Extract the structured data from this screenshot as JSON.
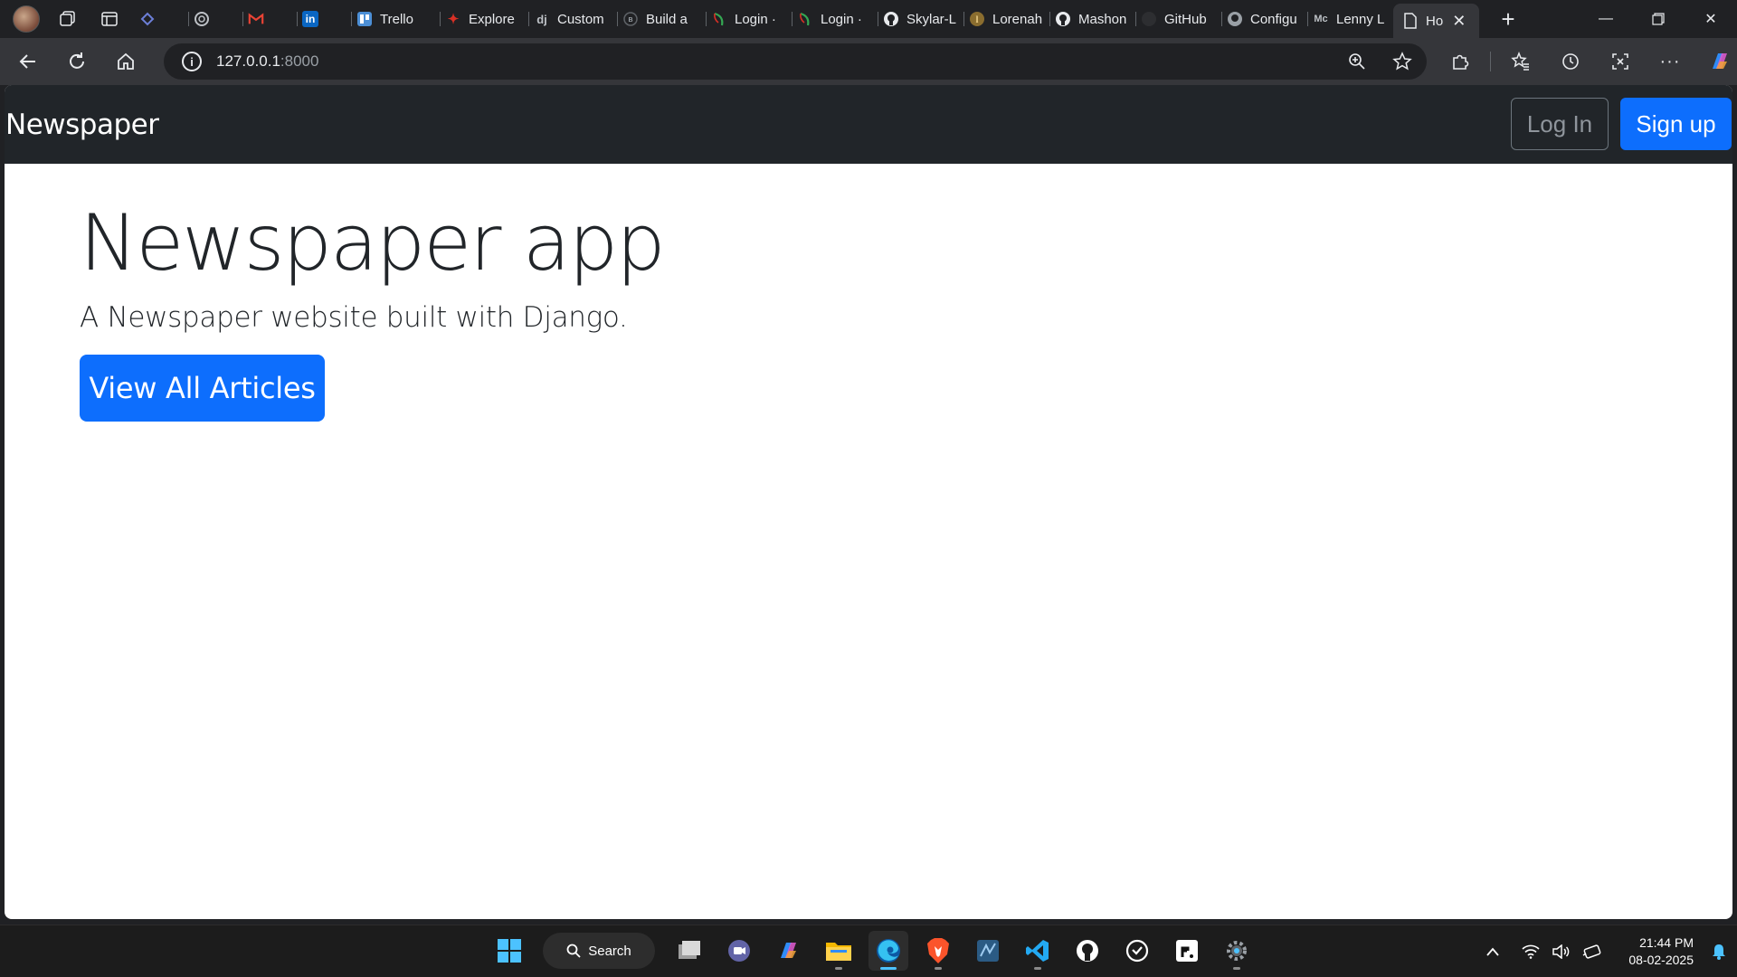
{
  "browser": {
    "tabs": [
      {
        "label": "",
        "icon": "perplexity-icon"
      },
      {
        "label": "",
        "icon": "chatgpt-icon"
      },
      {
        "label": "",
        "icon": "gmail-icon"
      },
      {
        "label": "",
        "icon": "linkedin-icon"
      },
      {
        "label": "Trello",
        "icon": "trello-icon"
      },
      {
        "label": "Explore",
        "icon": "maple-leaf-icon"
      },
      {
        "label": "Custom",
        "icon": "django-icon"
      },
      {
        "label": "Build a",
        "icon": "site-icon"
      },
      {
        "label": "Login ·",
        "icon": "leaf-icon"
      },
      {
        "label": "Login ·",
        "icon": "leaf-icon"
      },
      {
        "label": "Skylar-L",
        "icon": "github-icon"
      },
      {
        "label": "Lorenah",
        "icon": "coin-icon"
      },
      {
        "label": "Mashon",
        "icon": "github-icon"
      },
      {
        "label": "GitHub",
        "icon": "github-icon"
      },
      {
        "label": "Configu",
        "icon": "github-icon"
      },
      {
        "label": "Lenny L",
        "icon": "medium-icon"
      }
    ],
    "active_tab": {
      "label": "Ho",
      "icon": "page-icon"
    },
    "address": {
      "host": "127.0.0.1",
      "port": ":8000"
    }
  },
  "site": {
    "brand": "Newspaper",
    "login_label": "Log In",
    "signup_label": "Sign up",
    "hero_title": "Newspaper app",
    "hero_lead": "A Newspaper website built with Django.",
    "cta_label": "View All Articles"
  },
  "taskbar": {
    "search_label": "Search",
    "time": "21:44 PM",
    "date": "08-02-2025"
  },
  "colors": {
    "navbar_bg": "#212529",
    "primary": "#0d6efd",
    "browser_chrome": "#202124"
  }
}
